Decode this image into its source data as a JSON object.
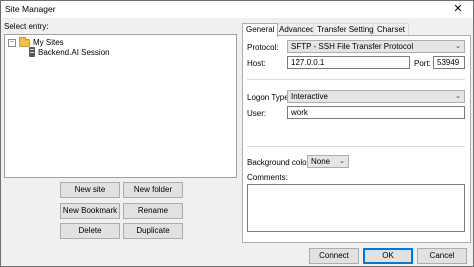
{
  "window": {
    "title": "Site Manager",
    "close_glyph": "✕"
  },
  "left": {
    "select_entry_label": "Select entry:"
  },
  "tree": {
    "root": {
      "label": "My Sites",
      "expander": "−",
      "icon": "folder-icon"
    },
    "child": {
      "label": "Backend.AI Session",
      "icon": "server-icon"
    }
  },
  "left_buttons": {
    "new_site": "New site",
    "new_folder": "New folder",
    "new_bookmark": "New Bookmark",
    "rename": "Rename",
    "delete": "Delete",
    "duplicate": "Duplicate"
  },
  "tabs": [
    "General",
    "Advanced",
    "Transfer Settings",
    "Charset"
  ],
  "general": {
    "protocol_label": "Protocol:",
    "protocol_value": "SFTP - SSH File Transfer Protocol",
    "host_label": "Host:",
    "host_value": "127.0.0.1",
    "port_label": "Port:",
    "port_value": "53949",
    "logon_type_label": "Logon Type:",
    "logon_type_value": "Interactive",
    "user_label": "User:",
    "user_value": "work",
    "background_color_label": "Background color:",
    "background_color_value": "None",
    "comments_label": "Comments:",
    "comments_value": ""
  },
  "footer": {
    "connect": "Connect",
    "ok": "OK",
    "cancel": "Cancel"
  },
  "colors": {
    "accent": "#0078d7",
    "folder": "#f3c14a",
    "window_bg": "#f0f0f0"
  }
}
